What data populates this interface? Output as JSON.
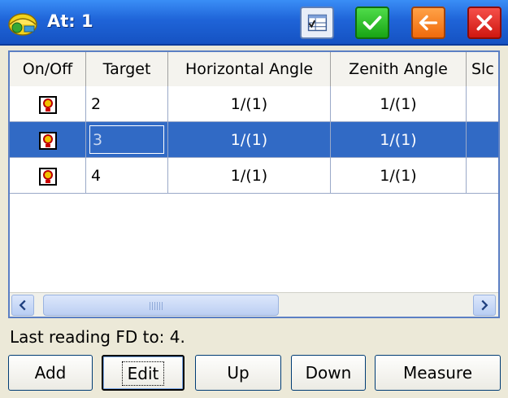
{
  "title": "At: 1",
  "columns": [
    "On/Off",
    "Target",
    "Horizontal Angle",
    "Zenith Angle",
    "Slc"
  ],
  "rows": [
    {
      "target": "2",
      "horizontal_angle": "1/(1)",
      "zenith_angle": "1/(1)",
      "selected": false
    },
    {
      "target": "3",
      "horizontal_angle": "1/(1)",
      "zenith_angle": "1/(1)",
      "selected": true
    },
    {
      "target": "4",
      "horizontal_angle": "1/(1)",
      "zenith_angle": "1/(1)",
      "selected": false
    }
  ],
  "status": "Last reading FD to: 4.",
  "buttons": {
    "add": "Add",
    "edit": "Edit",
    "up": "Up",
    "down": "Down",
    "measure": "Measure"
  },
  "scrollbar_grip": "III",
  "icons": {
    "app": "surveyor-helmet-icon",
    "view": "table-view-icon",
    "ok": "checkmark-icon",
    "back": "back-arrow-icon",
    "close": "close-icon",
    "row_toggle": "prism-target-icon"
  },
  "colors": {
    "title_bar": "#1f64d8",
    "selection": "#316ac5",
    "ok": "#18a414",
    "back": "#f06a0c",
    "close": "#cf1710"
  }
}
